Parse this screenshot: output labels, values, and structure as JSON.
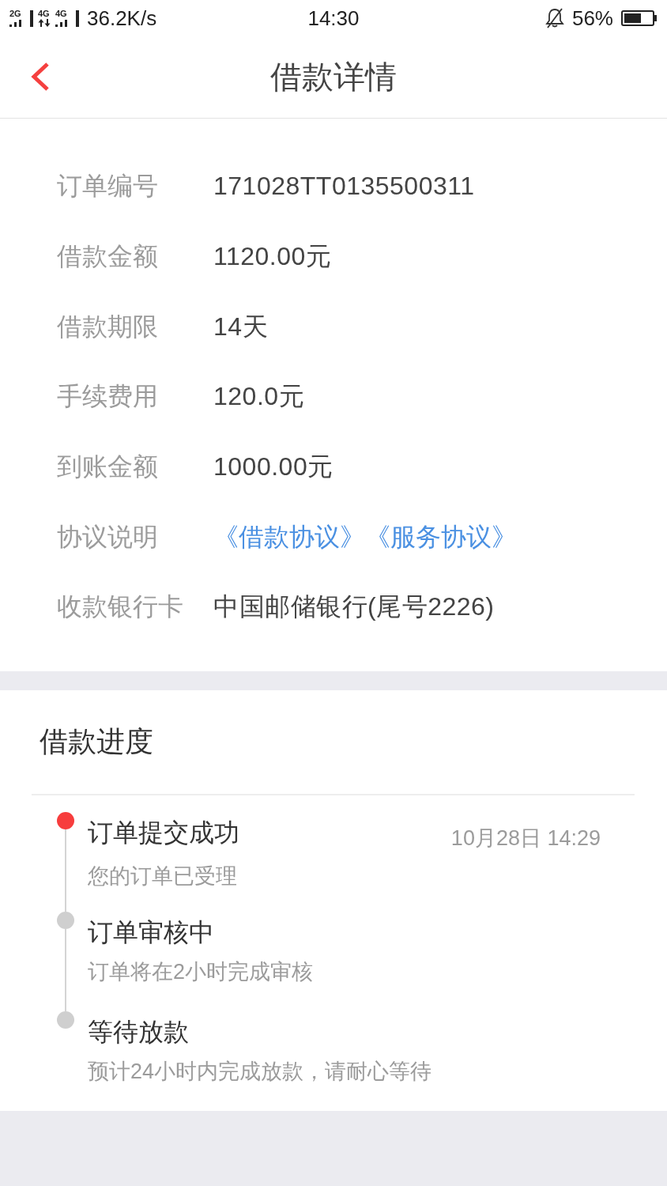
{
  "status_bar": {
    "networks": [
      {
        "label": "2G",
        "kind": "signal"
      },
      {
        "label": "4G",
        "kind": "data"
      },
      {
        "label": "4G",
        "kind": "signal"
      }
    ],
    "speed": "36.2K/s",
    "time": "14:30",
    "battery": "56%"
  },
  "header": {
    "title": "借款详情"
  },
  "details": [
    {
      "kind": "text",
      "label": "订单编号",
      "value": "171028TT0135500311"
    },
    {
      "kind": "text",
      "label": "借款金额",
      "value": "1120.00元"
    },
    {
      "kind": "text",
      "label": "借款期限",
      "value": "14天"
    },
    {
      "kind": "text",
      "label": "手续费用",
      "value": "120.0元"
    },
    {
      "kind": "text",
      "label": "到账金额",
      "value": "1000.00元"
    },
    {
      "kind": "links",
      "label": "协议说明",
      "links": [
        "《借款协议》",
        "《服务协议》"
      ]
    },
    {
      "kind": "text",
      "label": "收款银行卡",
      "value": "中国邮储银行(尾号2226)"
    }
  ],
  "progress": {
    "title": "借款进度",
    "steps": [
      {
        "title": "订单提交成功",
        "subtitle": "您的订单已受理",
        "time": "10月28日 14:29",
        "done": true
      },
      {
        "title": "订单审核中",
        "subtitle": "订单将在2小时完成审核",
        "done": false
      },
      {
        "title": "等待放款",
        "subtitle": "预计24小时内完成放款，请耐心等待",
        "done": false
      }
    ]
  }
}
